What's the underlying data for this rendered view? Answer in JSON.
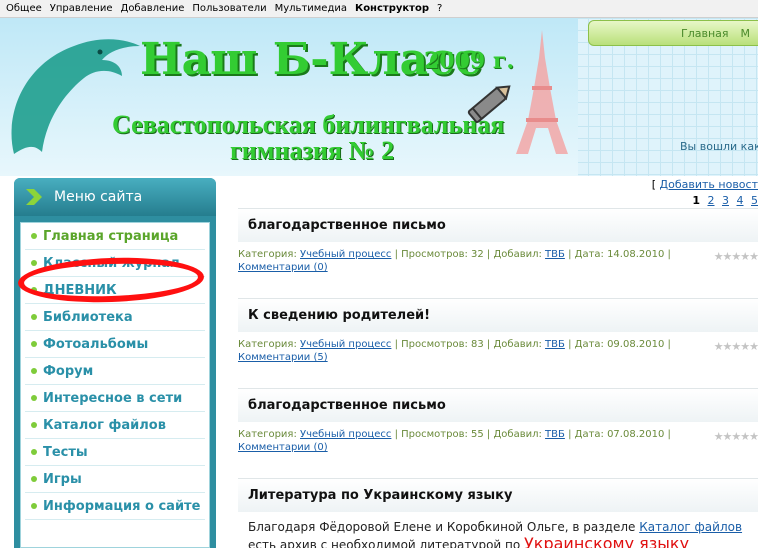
{
  "topbar": {
    "items": [
      "Общее",
      "Управление",
      "Добавление",
      "Пользователи",
      "Мультимедиа",
      "Конструктор",
      "?"
    ]
  },
  "header": {
    "title": "Наш Б-Класс",
    "year": "2009 г.",
    "subtitle_line1": "Севастопольская билингвальная",
    "subtitle_line2": "гимназия № 2",
    "nav_home": "Главная",
    "nav_more": "М",
    "login_text": "Вы вошли как"
  },
  "sidebar": {
    "title": "Меню сайта",
    "items": [
      {
        "label": "Главная страница"
      },
      {
        "label": "Классный журнал"
      },
      {
        "label": "ДНЕВНИК"
      },
      {
        "label": "Библиотека"
      },
      {
        "label": "Фотоальбомы"
      },
      {
        "label": "Форум"
      },
      {
        "label": "Интересное в сети"
      },
      {
        "label": "Каталог файлов"
      },
      {
        "label": "Тесты"
      },
      {
        "label": "Игры"
      },
      {
        "label": "Информация о сайте"
      }
    ]
  },
  "main": {
    "add_news_bracket": "[",
    "add_news_link": "Добавить новост",
    "pager": [
      "1",
      "2",
      "3",
      "4",
      "5"
    ],
    "entries": [
      {
        "title": "благодарственное письмо",
        "category_label": "Категория:",
        "category": "Учебный процесс",
        "views": "| Просмотров: 32 | Добавил:",
        "author": "ТВБ",
        "date": "| Дата: 14.08.2010 |",
        "comments": "Комментарии (0)"
      },
      {
        "title": "К сведению родителей!",
        "category_label": "Категория:",
        "category": "Учебный процесс",
        "views": "| Просмотров: 83 | Добавил:",
        "author": "ТВБ",
        "date": "| Дата: 09.08.2010 |",
        "comments": "Комментарии (5)"
      },
      {
        "title": "благодарственное письмо",
        "category_label": "Категория:",
        "category": "Учебный процесс",
        "views": "| Просмотров: 55 | Добавил:",
        "author": "ТВБ",
        "date": "| Дата: 07.08.2010 |",
        "comments": "Комментарии (0)"
      },
      {
        "title": "Литература по Украинскому языку",
        "excerpt_text": "Благодаря Фёдоровой Елене и Коробкиной Ольге, в разделе",
        "excerpt_link": "Каталог файлов",
        "excerpt_line2": "есть архив с необходимой литературой по",
        "excerpt_red": "Украинскому языку"
      }
    ]
  },
  "colors": {
    "sidebar_bg": "#2e8ea0",
    "menu_text": "#2a90a8",
    "active_menu": "#5aa52a",
    "title_green": "#33cc33",
    "highlight_circle": "#ff1010"
  }
}
